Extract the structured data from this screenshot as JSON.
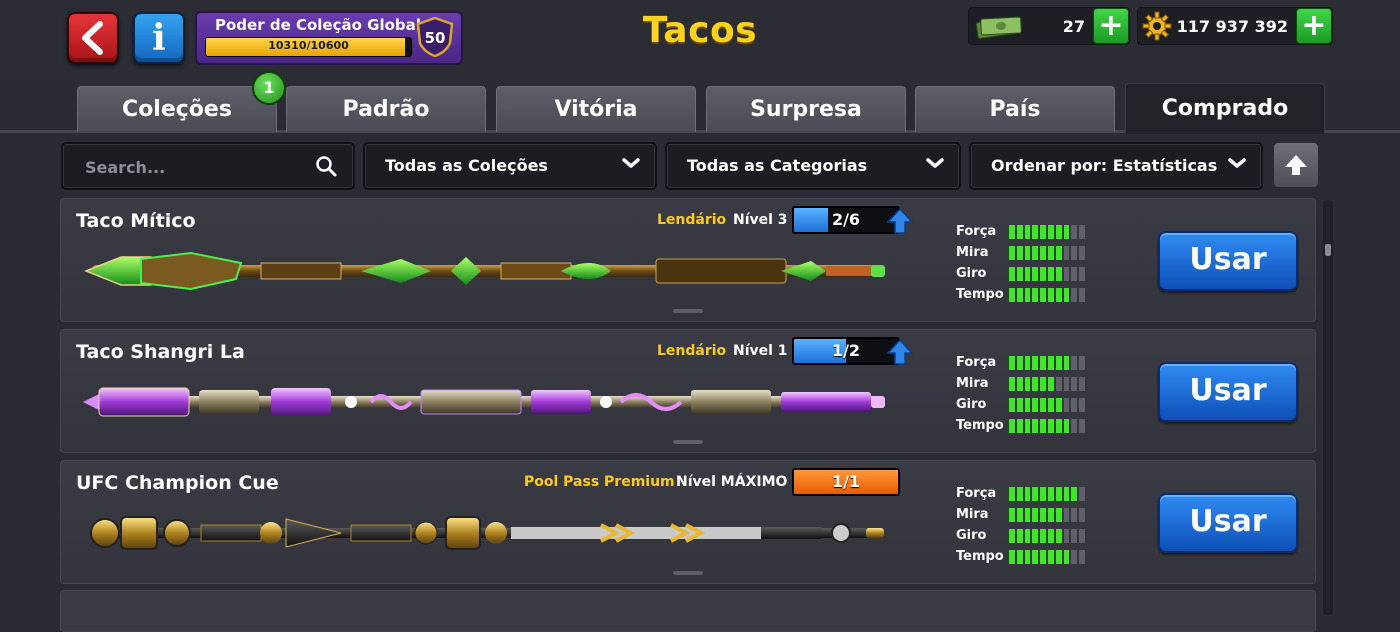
{
  "header": {
    "title": "Tacos",
    "power_title": "Poder de Coleção Global",
    "power_value": "10310/10600",
    "power_progress": 0.973,
    "power_level": "50",
    "cash": "27",
    "coins": "117 937 392"
  },
  "tabs": [
    {
      "label": "Coleções",
      "badge": "1"
    },
    {
      "label": "Padrão"
    },
    {
      "label": "Vitória"
    },
    {
      "label": "Surpresa"
    },
    {
      "label": "País"
    },
    {
      "label": "Comprado",
      "active": true
    }
  ],
  "filters": {
    "search_placeholder": "Search...",
    "collections": "Todas as Coleções",
    "categories": "Todas as Categorias",
    "sort": "Ordenar por: Estatísticas"
  },
  "stat_labels": [
    "Força",
    "Mira",
    "Giro",
    "Tempo"
  ],
  "cues": [
    {
      "name": "Taco Mítico",
      "rarity": "Lendário",
      "level": "Nível 3",
      "progress": "2/6",
      "progress_fraction": 0.33,
      "upgradable": true,
      "stats": [
        8,
        7,
        7,
        8
      ],
      "button": "Usar"
    },
    {
      "name": "Taco Shangri La",
      "rarity": "Lendário",
      "level": "Nível 1",
      "progress": "1/2",
      "progress_fraction": 0.5,
      "upgradable": true,
      "stats": [
        8,
        6,
        7,
        8
      ],
      "button": "Usar"
    },
    {
      "name": "UFC Champion Cue",
      "rarity": "Pool Pass Premium",
      "level": "Nível MÁXIMO",
      "progress": "1/1",
      "progress_fraction": 1.0,
      "upgradable": false,
      "stats": [
        9,
        7,
        7,
        8
      ],
      "button": "Usar"
    }
  ],
  "colors": {
    "accent_yellow": "#ffd21f",
    "button_blue": "#1e6fd8",
    "stat_green": "#3fe62a",
    "plus_green": "#2fbf3a"
  }
}
